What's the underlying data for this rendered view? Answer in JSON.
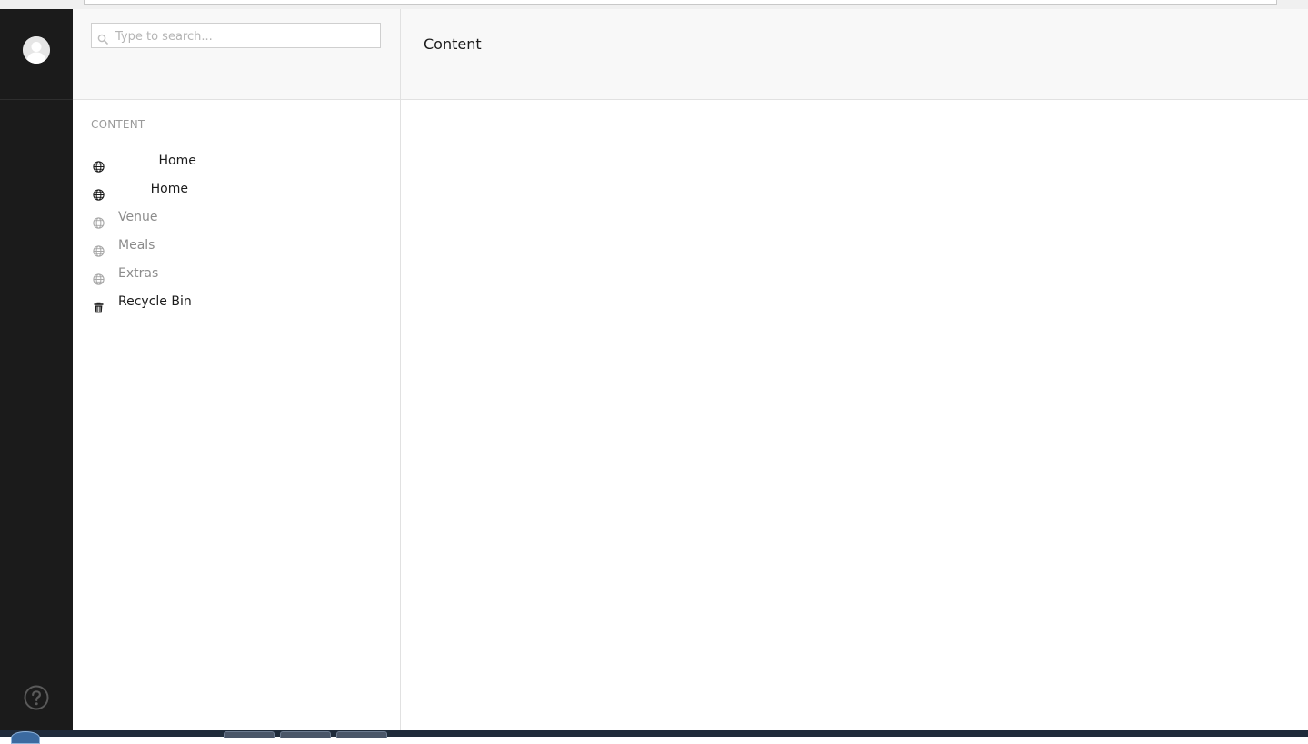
{
  "search": {
    "placeholder": "Type to search..."
  },
  "tree": {
    "section_title": "CONTENT",
    "items": [
      {
        "label": "          Home",
        "icon": "globe-icon",
        "muted": false
      },
      {
        "label": "        Home",
        "icon": "globe-icon",
        "muted": false
      },
      {
        "label": "Venue",
        "icon": "globe-icon",
        "muted": true
      },
      {
        "label": "Meals",
        "icon": "globe-icon",
        "muted": true
      },
      {
        "label": "Extras",
        "icon": "globe-icon",
        "muted": true
      },
      {
        "label": "Recycle Bin",
        "icon": "trash-icon",
        "muted": false
      }
    ]
  },
  "main": {
    "title": "Content"
  },
  "rail": {
    "avatar_icon": "user-avatar-icon",
    "help_icon": "help-icon"
  },
  "colors": {
    "rail_bg": "#1b1b1b",
    "header_bg": "#f8f8f8",
    "text": "#1b1b1b",
    "muted_text": "#8c8c8c"
  }
}
